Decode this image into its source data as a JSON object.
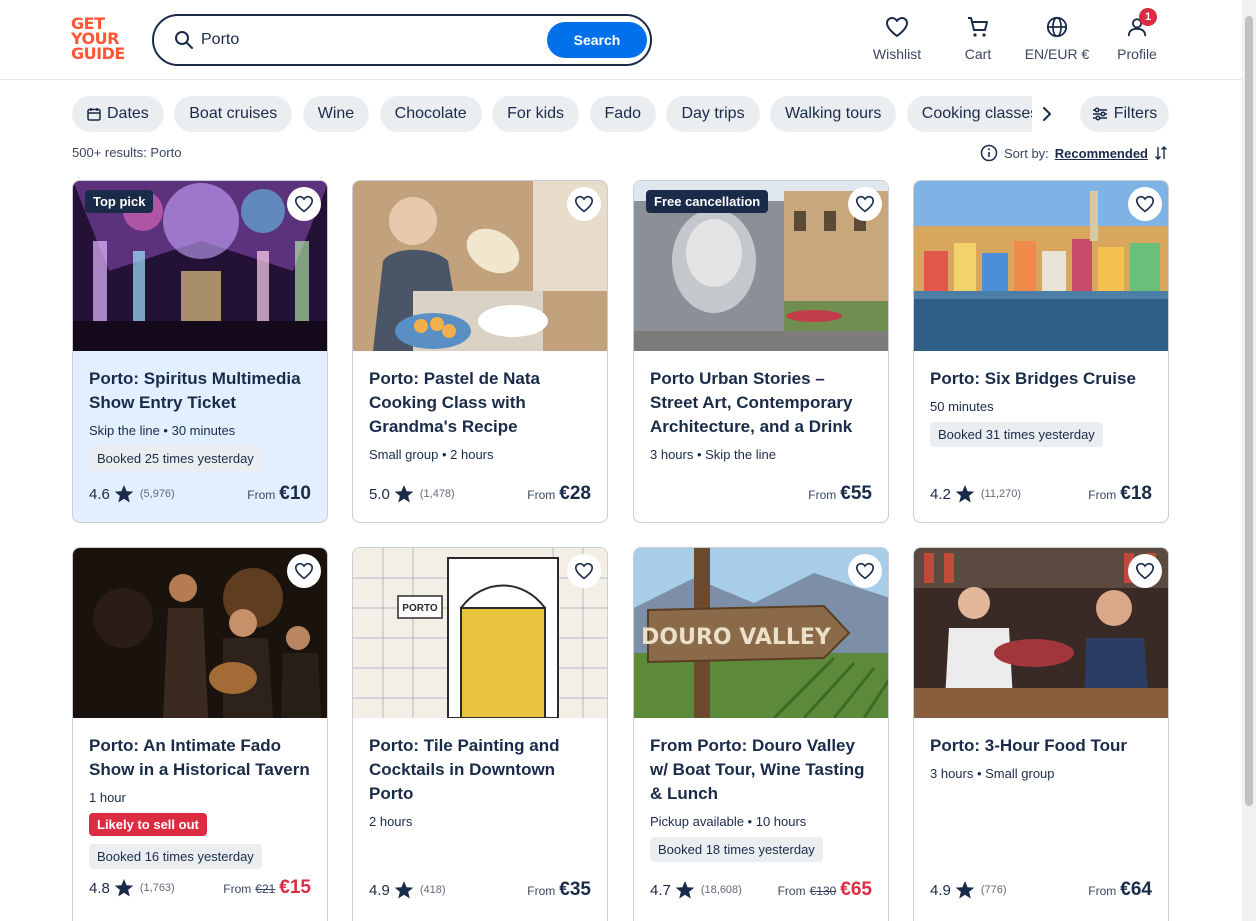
{
  "logo": {
    "lines": [
      "GET",
      "YOUR",
      "GUIDE"
    ]
  },
  "search": {
    "value": "Porto",
    "button": "Search"
  },
  "nav": {
    "wishlist": "Wishlist",
    "cart": "Cart",
    "locale": "EN/EUR €",
    "profile": "Profile",
    "profile_badge": "1"
  },
  "chips": [
    "Dates",
    "Boat cruises",
    "Wine",
    "Chocolate",
    "For kids",
    "Fado",
    "Day trips",
    "Walking tours",
    "Cooking classes"
  ],
  "filters_label": "Filters",
  "results_text": "500+ results: Porto",
  "sort": {
    "label": "Sort by:",
    "value": "Recommended"
  },
  "cards": [
    {
      "tag": "Top pick",
      "title": "Porto: Spiritus Multimedia Show Entry Ticket",
      "meta": "Skip the line • 30 minutes",
      "booked": "Booked 25 times yesterday",
      "sell": "",
      "rating": "4.6",
      "count": "(5,976)",
      "from": "From",
      "old": "",
      "price": "€10"
    },
    {
      "tag": "",
      "title": "Porto: Pastel de Nata Cooking Class with Grandma's Recipe",
      "meta": "Small group • 2 hours",
      "booked": "",
      "sell": "",
      "rating": "5.0",
      "count": "(1,478)",
      "from": "From",
      "old": "",
      "price": "€28"
    },
    {
      "tag": "Free cancellation",
      "title": "Porto Urban Stories – Street Art, Contemporary Architecture, and a Drink",
      "meta": "3 hours • Skip the line",
      "booked": "",
      "sell": "",
      "rating": "",
      "count": "",
      "from": "From",
      "old": "",
      "price": "€55"
    },
    {
      "tag": "",
      "title": "Porto: Six Bridges Cruise",
      "meta": "50 minutes",
      "booked": "Booked 31 times yesterday",
      "sell": "",
      "rating": "4.2",
      "count": "(11,270)",
      "from": "From",
      "old": "",
      "price": "€18"
    },
    {
      "tag": "",
      "title": "Porto: An Intimate Fado Show in a Historical Tavern",
      "meta": "1 hour",
      "booked": "Booked 16 times yesterday",
      "sell": "Likely to sell out",
      "rating": "4.8",
      "count": "(1,763)",
      "from": "From",
      "old": "€21",
      "price": "€15"
    },
    {
      "tag": "",
      "title": "Porto: Tile Painting and Cocktails in Downtown Porto",
      "meta": "2 hours",
      "booked": "",
      "sell": "",
      "rating": "4.9",
      "count": "(418)",
      "from": "From",
      "old": "",
      "price": "€35"
    },
    {
      "tag": "",
      "title": "From Porto: Douro Valley w/ Boat Tour, Wine Tasting & Lunch",
      "meta": "Pickup available • 10 hours",
      "booked": "Booked 18 times yesterday",
      "sell": "",
      "rating": "4.7",
      "count": "(18,608)",
      "from": "From",
      "old": "€130",
      "price": "€65"
    },
    {
      "tag": "",
      "title": "Porto: 3-Hour Food Tour",
      "meta": "3 hours • Small group",
      "booked": "",
      "sell": "",
      "rating": "4.9",
      "count": "(776)",
      "from": "From",
      "old": "",
      "price": "€64"
    }
  ],
  "image_texts": {
    "tile_sign": "PORTO",
    "douro_sign": "DOURO VALLEY"
  },
  "colors": {
    "brand": "#ff5533",
    "primary": "#0071eb",
    "navy": "#1a2b49",
    "sale": "#dc2c42",
    "chip_bg": "#ebeef1"
  }
}
